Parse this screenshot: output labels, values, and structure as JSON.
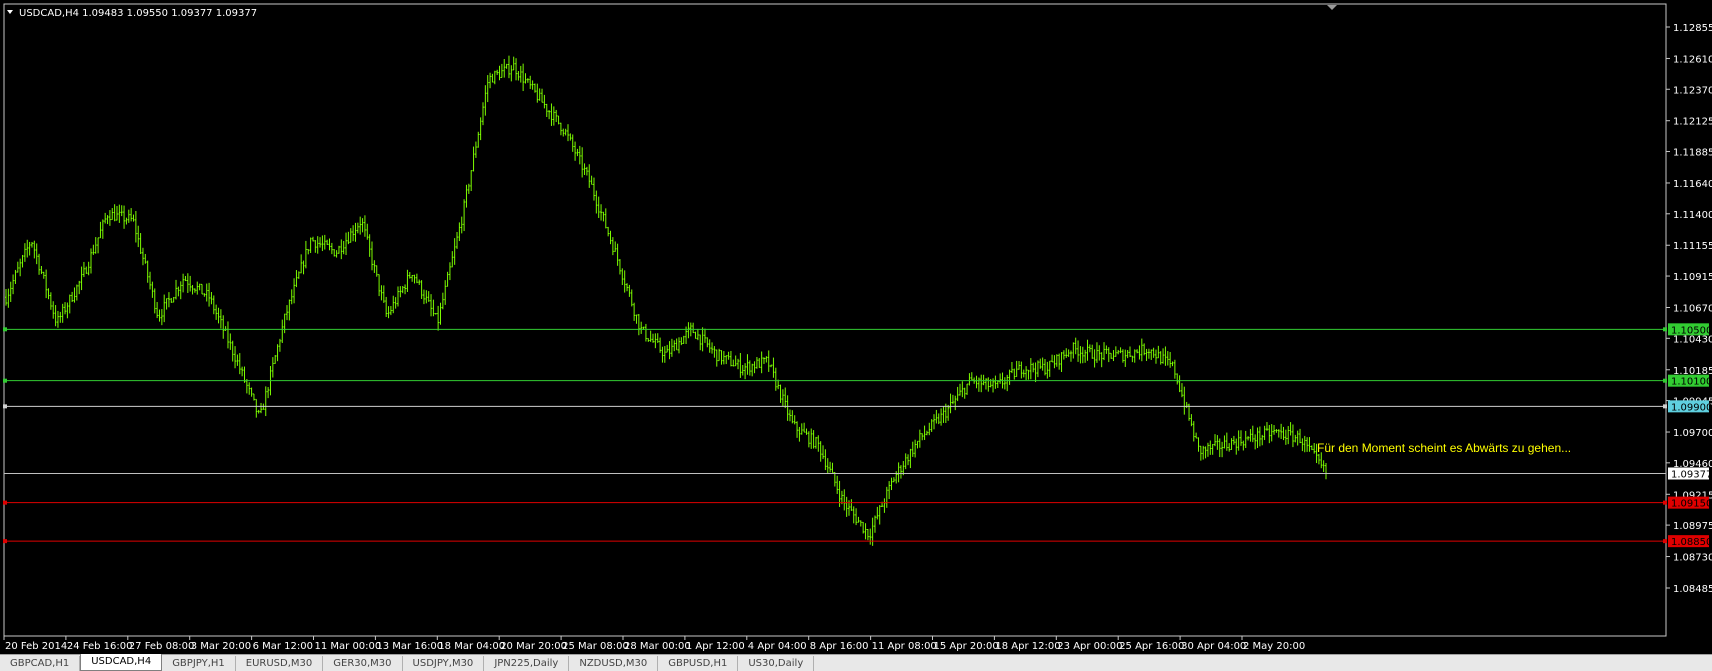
{
  "chart": {
    "symbol_header": "USDCAD,H4  1.09483 1.09550 1.09377 1.09377",
    "annotation": "Für den Moment scheint es Abwärts zu gehen...",
    "price_axis": [
      "1.12855",
      "1.12610",
      "1.12370",
      "1.12125",
      "1.11885",
      "1.11640",
      "1.11400",
      "1.11155",
      "1.10915",
      "1.10670",
      "1.10430",
      "1.10185",
      "1.09945",
      "1.09700",
      "1.09460",
      "1.09215",
      "1.08975",
      "1.08730",
      "1.08485"
    ],
    "time_axis": [
      "20 Feb 2014",
      "24 Feb 16:00",
      "27 Feb 08:00",
      "3 Mar 20:00",
      "6 Mar 12:00",
      "11 Mar 00:00",
      "13 Mar 16:00",
      "18 Mar 04:00",
      "20 Mar 20:00",
      "25 Mar 08:00",
      "28 Mar 00:00",
      "1 Apr 12:00",
      "4 Apr 04:00",
      "8 Apr 16:00",
      "11 Apr 08:00",
      "15 Apr 20:00",
      "18 Apr 12:00",
      "23 Apr 00:00",
      "25 Apr 16:00",
      "30 Apr 04:00",
      "2 May 20:00"
    ],
    "horizontal_lines": [
      {
        "label": "1.10500",
        "color": "#32cd32",
        "label_bg": "#32cd32",
        "label_color": "#000000"
      },
      {
        "label": "1.10100",
        "color": "#32cd32",
        "label_bg": "#32cd32",
        "label_color": "#000000"
      },
      {
        "label": "1.09900",
        "color": "#d0d0d0",
        "label_bg": "#5fd0e0",
        "label_color": "#000000"
      },
      {
        "label": "1.09377",
        "color": "#c0c0c0",
        "label_bg": "#ffffff",
        "label_color": "#000000"
      },
      {
        "label": "1.09150",
        "color": "#e00000",
        "label_bg": "#e00000",
        "label_color": "#000000"
      },
      {
        "label": "1.08850",
        "color": "#e00000",
        "label_bg": "#e00000",
        "label_color": "#000000"
      }
    ],
    "colors": {
      "background": "#000000",
      "candles": "#7cfc00",
      "grid": "#ffffff",
      "annotation": "#ffff00"
    }
  },
  "chart_data": {
    "type": "candlestick",
    "title": "USDCAD,H4",
    "ylim": [
      1.08485,
      1.12855
    ],
    "close_path": [
      [
        "20 Feb 2014",
        1.1075
      ],
      [
        "21 Feb 2014",
        1.112
      ],
      [
        "24 Feb 2014",
        1.1055
      ],
      [
        "25 Feb 2014",
        1.109
      ],
      [
        "26 Feb 2014",
        1.114
      ],
      [
        "27 Feb 2014",
        1.1135
      ],
      [
        "28 Feb 2014",
        1.106
      ],
      [
        "3 Mar 2014",
        1.109
      ],
      [
        "4 Mar 2014",
        1.1075
      ],
      [
        "5 Mar 2014",
        1.103
      ],
      [
        "6 Mar 2014",
        1.098
      ],
      [
        "7 Mar 2014",
        1.106
      ],
      [
        "10 Mar 2014",
        1.112
      ],
      [
        "11 Mar 2014",
        1.111
      ],
      [
        "12 Mar 2014",
        1.1135
      ],
      [
        "13 Mar 2014",
        1.106
      ],
      [
        "14 Mar 2014",
        1.1095
      ],
      [
        "17 Mar 2014",
        1.1055
      ],
      [
        "18 Mar 2014",
        1.114
      ],
      [
        "19 Mar 2014",
        1.1245
      ],
      [
        "20 Mar 2014",
        1.1255
      ],
      [
        "21 Mar 2014",
        1.123
      ],
      [
        "24 Mar 2014",
        1.1205
      ],
      [
        "25 Mar 2014",
        1.1165
      ],
      [
        "26 Mar 2014",
        1.111
      ],
      [
        "27 Mar 2014",
        1.105
      ],
      [
        "28 Mar 2014",
        1.103
      ],
      [
        "31 Mar 2014",
        1.105
      ],
      [
        "1 Apr 2014",
        1.103
      ],
      [
        "2 Apr 2014",
        1.102
      ],
      [
        "3 Apr 2014",
        1.1025
      ],
      [
        "4 Apr 2014",
        1.0975
      ],
      [
        "7 Apr 2014",
        1.096
      ],
      [
        "8 Apr 2014",
        1.0915
      ],
      [
        "9 Apr 2014",
        1.089
      ],
      [
        "10 Apr 2014",
        1.0935
      ],
      [
        "11 Apr 2014",
        1.0965
      ],
      [
        "14 Apr 2014",
        1.0985
      ],
      [
        "15 Apr 2014",
        1.101
      ],
      [
        "16 Apr 2014",
        1.1005
      ],
      [
        "17 Apr 2014",
        1.102
      ],
      [
        "18 Apr 2014",
        1.102
      ],
      [
        "21 Apr 2014",
        1.1035
      ],
      [
        "22 Apr 2014",
        1.103
      ],
      [
        "23 Apr 2014",
        1.103
      ],
      [
        "24 Apr 2014",
        1.1035
      ],
      [
        "25 Apr 2014",
        1.102
      ],
      [
        "28 Apr 2014",
        1.0955
      ],
      [
        "29 Apr 2014",
        1.096
      ],
      [
        "30 Apr 2014",
        1.0965
      ],
      [
        "1 May 2014",
        1.097
      ],
      [
        "2 May 2014",
        1.0965
      ],
      [
        "5 May 2014",
        1.09377
      ]
    ],
    "levels": [
      1.105,
      1.101,
      1.099,
      1.09377,
      1.0915,
      1.0885
    ]
  },
  "tabs": [
    {
      "label": "GBPCAD,H1",
      "active": false
    },
    {
      "label": "USDCAD,H4",
      "active": true
    },
    {
      "label": "GBPJPY,H1",
      "active": false
    },
    {
      "label": "EURUSD,M30",
      "active": false
    },
    {
      "label": "GER30,M30",
      "active": false
    },
    {
      "label": "USDJPY,M30",
      "active": false
    },
    {
      "label": "JPN225,Daily",
      "active": false
    },
    {
      "label": "NZDUSD,M30",
      "active": false
    },
    {
      "label": "GBPUSD,H1",
      "active": false
    },
    {
      "label": "US30,Daily",
      "active": false
    }
  ]
}
